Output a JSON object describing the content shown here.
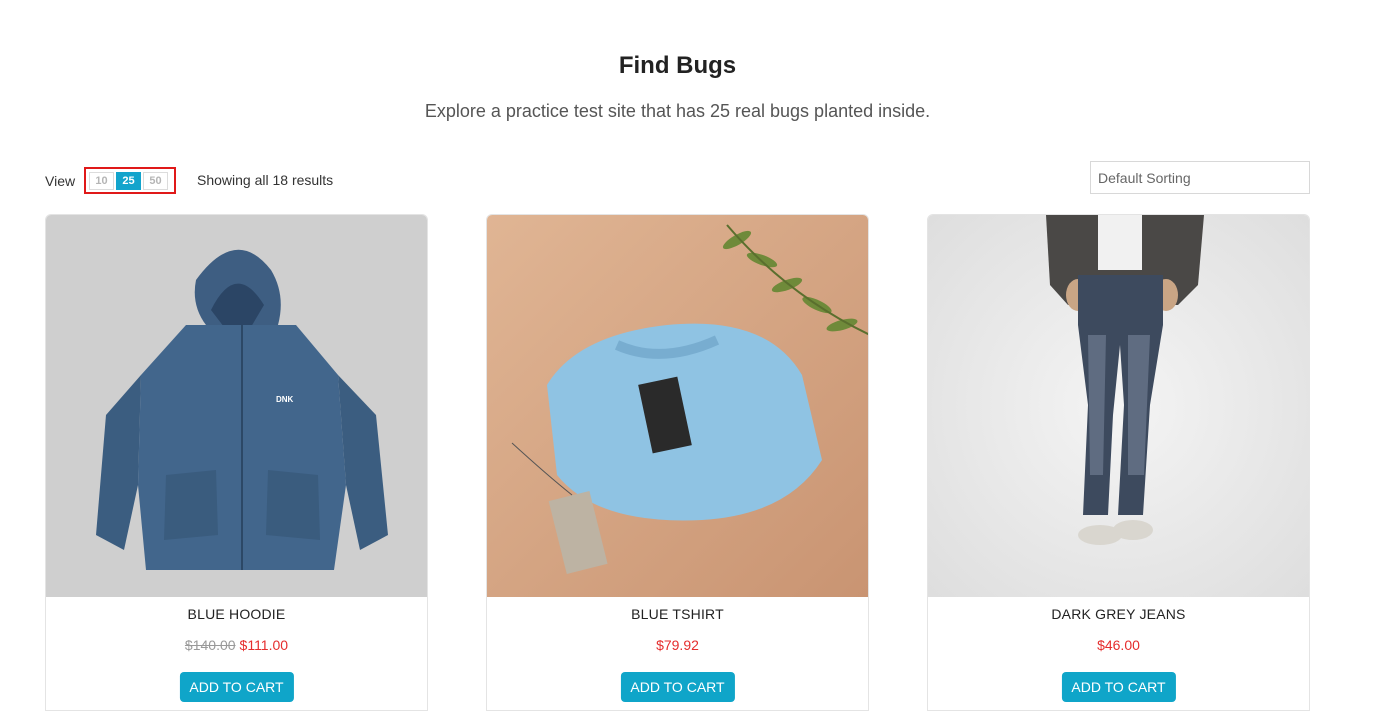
{
  "header": {
    "title": "Find Bugs",
    "subtitle": "Explore a practice test site that has 25 real bugs planted inside."
  },
  "toolbar": {
    "view_label": "View",
    "view_options": [
      "10",
      "25",
      "50"
    ],
    "selected_view": "25",
    "results_text": "Showing all 18 results",
    "sort_select_value": "Default Sorting",
    "highlight_color": "#e01919"
  },
  "products": [
    {
      "name": "BLUE HOODIE",
      "old_price": "$140.00",
      "price": "$111.00",
      "button_label": "ADD TO CART",
      "image_icon": "blue-hoodie-image"
    },
    {
      "name": "BLUE TSHIRT",
      "old_price": "",
      "price": "$79.92",
      "button_label": "ADD TO CART",
      "image_icon": "blue-tshirt-image"
    },
    {
      "name": "DARK GREY JEANS",
      "old_price": "",
      "price": "$46.00",
      "button_label": "ADD TO CART",
      "image_icon": "dark-grey-jeans-image"
    }
  ],
  "colors": {
    "accent": "#0fa5c9",
    "sale_price": "#e52d2d",
    "old_price": "#999999"
  }
}
